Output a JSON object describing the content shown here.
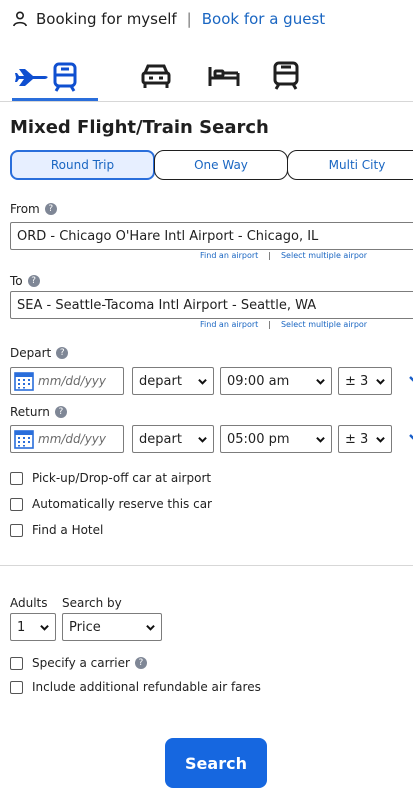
{
  "header": {
    "booking_self": "Booking for myself",
    "separator": "|",
    "booking_guest": "Book for a guest"
  },
  "modes": [
    {
      "name": "flight-train",
      "icon": "plane-train-icon",
      "active": true
    },
    {
      "name": "car",
      "icon": "car-icon",
      "active": false
    },
    {
      "name": "hotel",
      "icon": "bed-icon",
      "active": false
    },
    {
      "name": "train",
      "icon": "train-icon",
      "active": false
    }
  ],
  "title": "Mixed Flight/Train Search",
  "trip_tabs": [
    "Round Trip",
    "One Way",
    "Multi City"
  ],
  "from": {
    "label": "From",
    "value": "ORD - Chicago O'Hare Intl Airport - Chicago, IL",
    "link_find": "Find an airport",
    "link_sep": "|",
    "link_multiple": "Select multiple airpor"
  },
  "to": {
    "label": "To",
    "value": "SEA - Seattle-Tacoma Intl Airport - Seattle, WA",
    "link_find": "Find an airport",
    "link_sep": "|",
    "link_multiple": "Select multiple airpor"
  },
  "depart": {
    "label": "Depart",
    "date_placeholder": "mm/dd/yyy",
    "mode": "depart",
    "time": "09:00 am",
    "range": "± 3"
  },
  "return": {
    "label": "Return",
    "date_placeholder": "mm/dd/yyy",
    "mode": "depart",
    "time": "05:00 pm",
    "range": "± 3"
  },
  "options": [
    "Pick-up/Drop-off car at airport",
    "Automatically reserve this car",
    "Find a Hotel"
  ],
  "adults": {
    "label": "Adults",
    "value": "1"
  },
  "search_by": {
    "label": "Search by",
    "value": "Price"
  },
  "extras": [
    "Specify a carrier",
    "Include additional refundable air fares"
  ],
  "search_button": "Search",
  "colors": {
    "accent": "#1667e0",
    "link": "#1a66c2",
    "tab_active_bg": "#e7efff"
  }
}
